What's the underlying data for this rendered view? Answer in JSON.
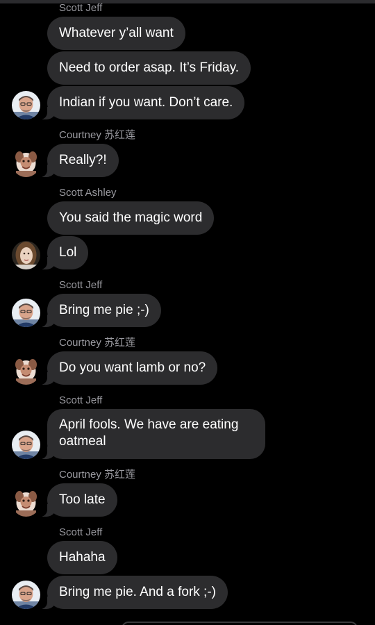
{
  "messages": [
    {
      "sender": "Scott Jeff",
      "text": "Whatever y’all want"
    },
    {
      "text": "Need to order asap.  It’s Friday."
    },
    {
      "text": "Indian if you want. Don’t care.",
      "avatar": "jeff-avatar"
    },
    {
      "sender": "Courtney 苏红莲",
      "text": "Really?!",
      "avatar": "courtney-avatar"
    },
    {
      "sender": "Scott Ashley",
      "text": "You said the magic word"
    },
    {
      "text": "Lol",
      "avatar": "ashley-avatar"
    },
    {
      "sender": "Scott Jeff",
      "text": "Bring me pie ;-)",
      "avatar": "jeff-avatar"
    },
    {
      "sender": "Courtney 苏红莲",
      "text": "Do you want lamb or no?",
      "avatar": "courtney-avatar"
    },
    {
      "sender": "Scott Jeff",
      "text_line1": "April fools.  We have are eating",
      "text_line2": "oatmeal",
      "avatar": "jeff-avatar"
    },
    {
      "sender": "Courtney 苏红莲",
      "text": "Too late",
      "avatar": "courtney-avatar"
    },
    {
      "sender": "Scott Jeff",
      "text": "Hahaha"
    },
    {
      "text": "Bring me pie.  And a fork ;-)",
      "avatar": "jeff-avatar"
    }
  ],
  "colors": {
    "background": "#000000",
    "bubble": "#2c2c2e",
    "sender_label": "#9a9aa0",
    "message_text": "#ffffff"
  }
}
